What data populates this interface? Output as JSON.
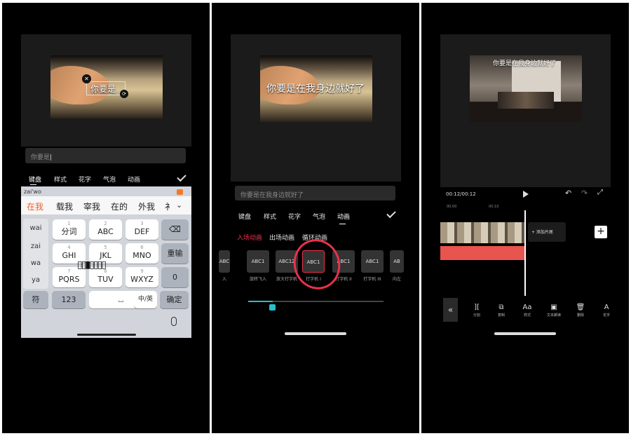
{
  "panel1": {
    "subtitle_preview": "你要是",
    "text_field_value": "你要是",
    "tabs": [
      "键盘",
      "样式",
      "花字",
      "气泡",
      "动画"
    ],
    "keyboard": {
      "pinyin_composition": "zai'wo",
      "candidates": [
        "在我",
        "载我",
        "宰我",
        "在的",
        "外我",
        "衤"
      ],
      "left_column": [
        "wai",
        "zai",
        "wa",
        "ya"
      ],
      "rows": [
        [
          {
            "num": "1",
            "label": "分词"
          },
          {
            "num": "2",
            "label": "ABC"
          },
          {
            "num": "3",
            "label": "DEF"
          }
        ],
        [
          {
            "num": "4",
            "label": "GHI"
          },
          {
            "num": "5",
            "label": "JKL"
          },
          {
            "num": "6",
            "label": "MNO"
          }
        ],
        [
          {
            "num": "7",
            "label": "PQRS"
          },
          {
            "num": "8",
            "label": "TUV"
          },
          {
            "num": "9",
            "label": "WXYZ"
          }
        ]
      ],
      "reenter_label": "重输",
      "zero_label": "0",
      "symbol_label": "符",
      "num_label": "123",
      "lang_label": "中/英",
      "confirm_label": "确定"
    }
  },
  "panel2": {
    "subtitle_preview": "你要是在我身边就好了",
    "text_field_value": "你要是在我身边就好了",
    "tabs": [
      "键盘",
      "样式",
      "花字",
      "气泡",
      "动画"
    ],
    "subtabs": [
      "入场动画",
      "出场动画",
      "循环动画"
    ],
    "tiles": [
      {
        "text": "ABC",
        "label": "入"
      },
      {
        "text": "ABC1",
        "label": "旋转飞入"
      },
      {
        "text": "ABC12",
        "label": "放大打字机"
      },
      {
        "text": "ABC1",
        "label": "打字机 I"
      },
      {
        "text": "ABC1",
        "label": "打字机 II"
      },
      {
        "text": "ABC1",
        "label": "打字机 III"
      },
      {
        "text": "AB",
        "label": "向左"
      }
    ],
    "accent_color": "#e8324b",
    "slider_color": "#2bbfc9"
  },
  "panel3": {
    "subtitle_preview": "你要是在我身边就好了",
    "time_display": "00:12/00:12",
    "ruler_labels": [
      "00:00",
      "00:10"
    ],
    "add_ending_label": "+ 添加片尾",
    "toolbar": [
      {
        "label": "分割",
        "icon": "split-icon"
      },
      {
        "label": "复制",
        "icon": "copy-icon"
      },
      {
        "label": "样式",
        "icon": "style-icon"
      },
      {
        "label": "文本朗读",
        "icon": "tts-icon"
      },
      {
        "label": "删除",
        "icon": "delete-icon"
      },
      {
        "label": "花字",
        "icon": "font-icon"
      }
    ],
    "track_color": "#e8544e"
  }
}
